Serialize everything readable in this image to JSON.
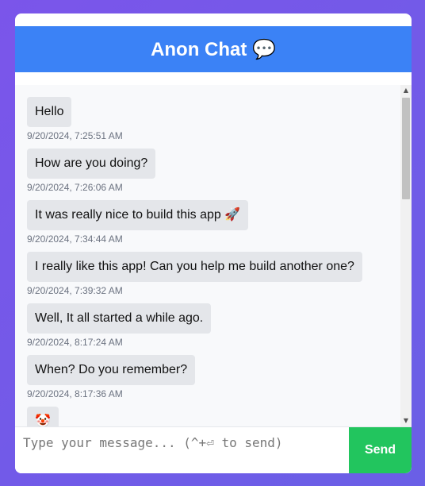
{
  "header": {
    "title": "Anon Chat 💬"
  },
  "messages": [
    {
      "text": "Hello",
      "timestamp": "9/20/2024, 7:25:51 AM"
    },
    {
      "text": "How are you doing?",
      "timestamp": "9/20/2024, 7:26:06 AM"
    },
    {
      "text": "It was really nice to build this app 🚀",
      "timestamp": "9/20/2024, 7:34:44 AM"
    },
    {
      "text": "I really like this app! Can you help me build another one?",
      "timestamp": "9/20/2024, 7:39:32 AM"
    },
    {
      "text": "Well, It all started a while ago.",
      "timestamp": "9/20/2024, 8:17:24 AM"
    },
    {
      "text": "When? Do you remember?",
      "timestamp": "9/20/2024, 8:17:36 AM"
    },
    {
      "text": "🤡",
      "timestamp": ""
    }
  ],
  "composer": {
    "placeholder": "Type your message... (^+⏎ to send)",
    "value": "",
    "send_label": "Send"
  },
  "colors": {
    "background": "#6a5fe6",
    "header": "#3b82f6",
    "send_button": "#22c55e",
    "bubble": "#e4e6ea"
  }
}
